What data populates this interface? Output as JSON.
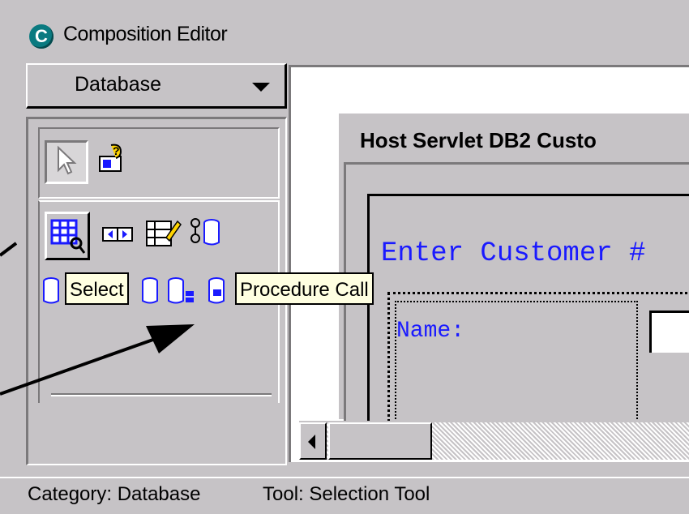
{
  "window": {
    "title": "Composition Editor",
    "logo_letter": "C"
  },
  "palette": {
    "category_selected": "Database",
    "icons_row1": [
      "selection-tool-icon",
      "bean-icon"
    ],
    "icons_row2": [
      "select-icon",
      "navigator-icon",
      "form-editor-icon",
      "procedure-call-icon"
    ],
    "icons_row3": [
      "database-icon",
      "database-2-icon",
      "database-table-icon",
      "database-link-icon"
    ]
  },
  "tooltips": {
    "select": "Select",
    "procedure_call": "Procedure Call"
  },
  "design": {
    "frame_title": "Host Servlet DB2 Custo",
    "enter_label": "Enter Customer #",
    "name_label": "Name:"
  },
  "status": {
    "category": "Category: Database",
    "tool": "Tool: Selection Tool"
  },
  "colors": {
    "form_text": "#1a1aff",
    "window_bg": "#c6c3c6",
    "tooltip_bg": "#ffffe1"
  }
}
